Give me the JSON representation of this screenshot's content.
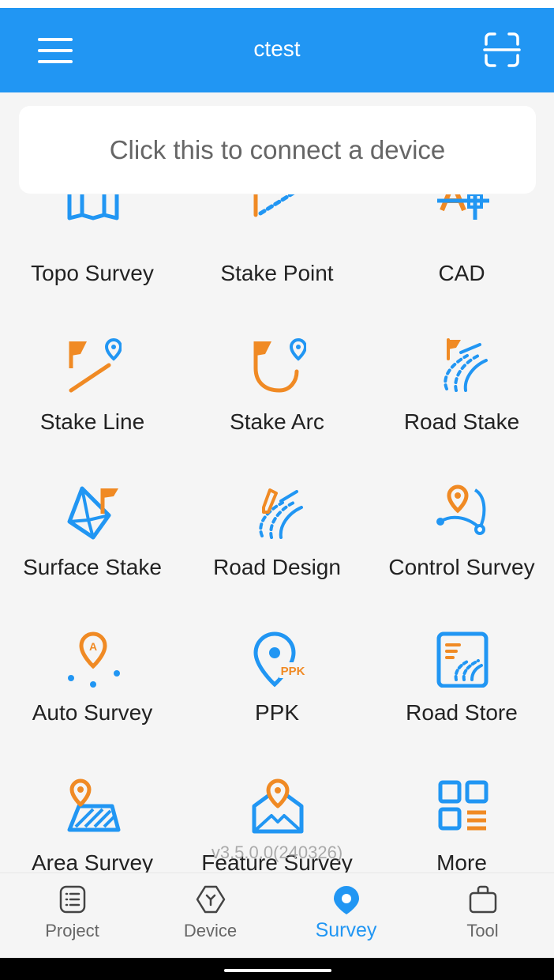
{
  "header": {
    "title": "ctest"
  },
  "connect_prompt": "Click this to connect a device",
  "version": "v3.5.0.0(240326)",
  "colors": {
    "primary": "#2196f3",
    "accent": "#f08a24"
  },
  "grid": {
    "items": [
      {
        "label": "Topo Survey",
        "icon": "topo-survey-icon"
      },
      {
        "label": "Stake Point",
        "icon": "stake-point-icon"
      },
      {
        "label": "CAD",
        "icon": "cad-icon"
      },
      {
        "label": "Stake Line",
        "icon": "stake-line-icon"
      },
      {
        "label": "Stake Arc",
        "icon": "stake-arc-icon"
      },
      {
        "label": "Road Stake",
        "icon": "road-stake-icon"
      },
      {
        "label": "Surface Stake",
        "icon": "surface-stake-icon"
      },
      {
        "label": "Road Design",
        "icon": "road-design-icon"
      },
      {
        "label": "Control Survey",
        "icon": "control-survey-icon"
      },
      {
        "label": "Auto Survey",
        "icon": "auto-survey-icon"
      },
      {
        "label": "PPK",
        "icon": "ppk-icon",
        "badge": "PPK"
      },
      {
        "label": "Road Store",
        "icon": "road-store-icon"
      },
      {
        "label": "Area Survey",
        "icon": "area-survey-icon"
      },
      {
        "label": "Feature Survey",
        "icon": "feature-survey-icon"
      },
      {
        "label": "More",
        "icon": "more-icon"
      }
    ]
  },
  "bottom_nav": {
    "tabs": [
      {
        "label": "Project",
        "icon": "project-icon"
      },
      {
        "label": "Device",
        "icon": "device-icon"
      },
      {
        "label": "Survey",
        "icon": "survey-icon",
        "active": true
      },
      {
        "label": "Tool",
        "icon": "tool-icon"
      }
    ]
  }
}
